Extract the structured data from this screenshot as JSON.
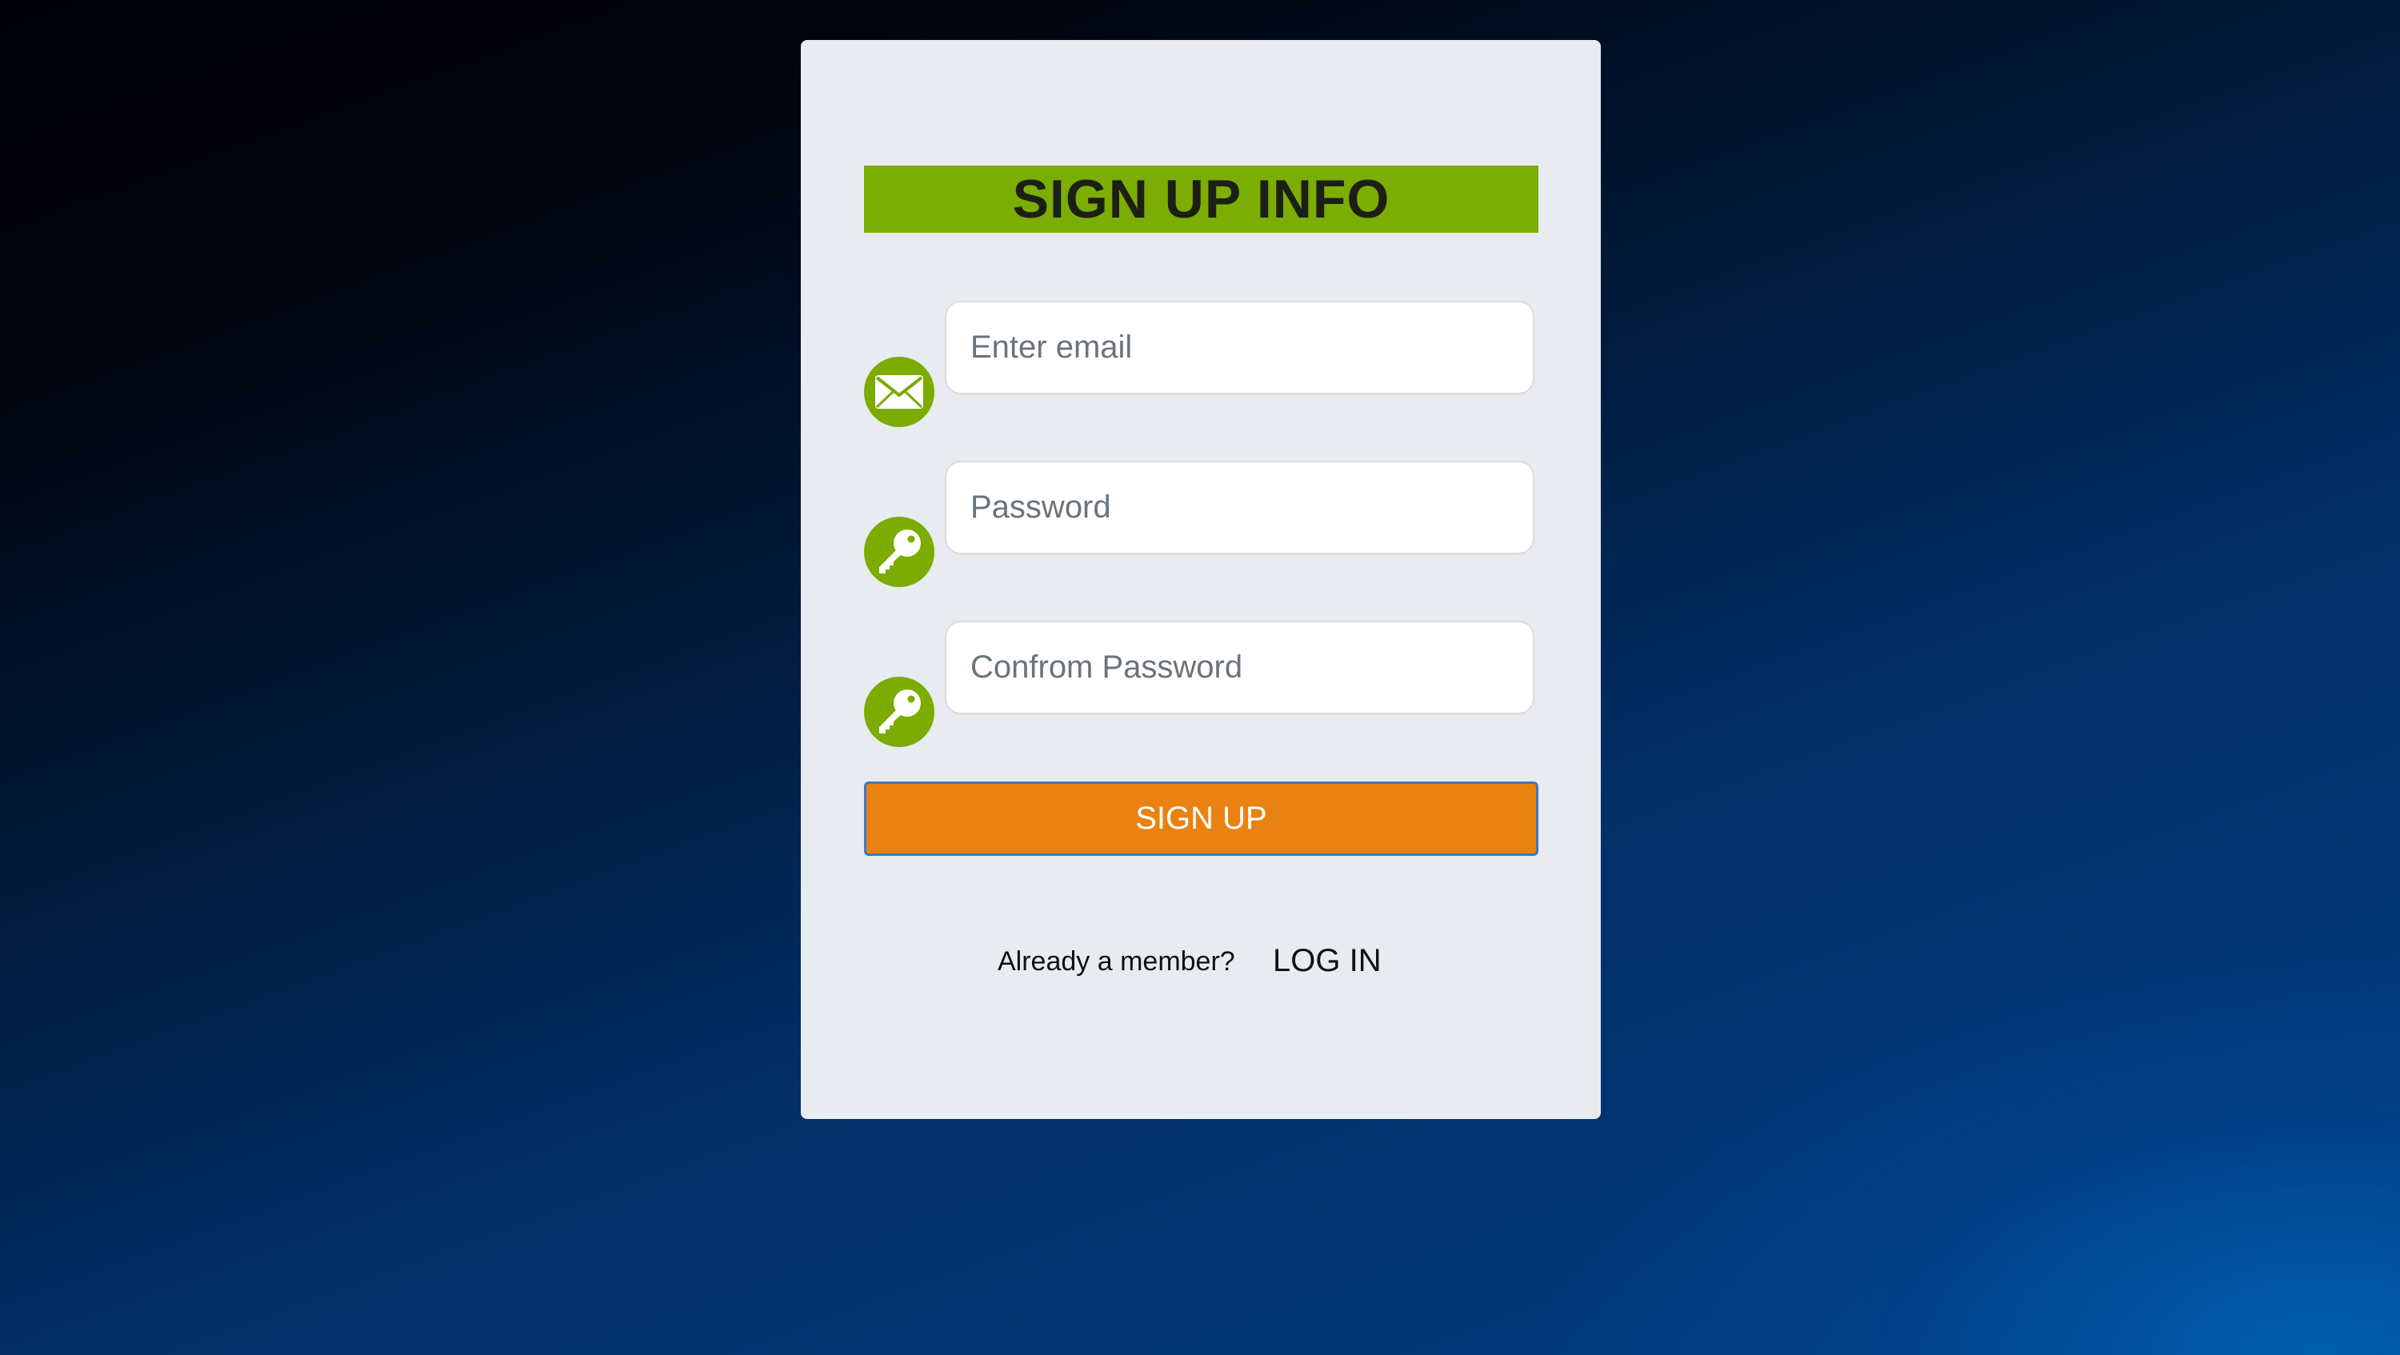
{
  "form": {
    "heading": "SIGN UP INFO",
    "email": {
      "placeholder": "Enter email",
      "value": "",
      "icon": "envelope-icon"
    },
    "password": {
      "placeholder": "Password",
      "value": "",
      "icon": "key-icon"
    },
    "confirm_password": {
      "placeholder": "Confrom Password",
      "value": "",
      "icon": "key-icon"
    },
    "submit_label": "SIGN UP",
    "member_prompt": "Already a member?",
    "login_label": "LOG IN"
  },
  "colors": {
    "accent_green": "#7cad02",
    "button_orange": "#e98210",
    "card_background": "#e8ebef",
    "button_border": "#3d79c4"
  }
}
